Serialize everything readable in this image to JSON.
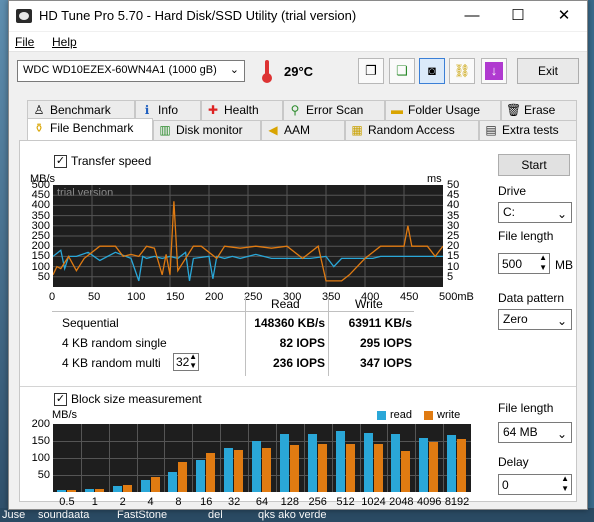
{
  "window": {
    "title": "HD Tune Pro 5.70 - Hard Disk/SSD Utility (trial version)",
    "minimize": "—",
    "maximize": "☐",
    "close": "✕"
  },
  "menu": [
    "File",
    "Help"
  ],
  "toolbar": {
    "drive": "WDC WD10EZEX-60WN4A1 (1000 gB)",
    "temperature": "29°C",
    "exit_label": "Exit",
    "icons": [
      "copy-text-icon",
      "copy-info-icon",
      "screenshot-camera-icon",
      "options-chain-icon",
      "save-arrow-icon"
    ]
  },
  "tabs_top": [
    {
      "label": "Benchmark",
      "icon": "dumbbell-icon"
    },
    {
      "label": "Info",
      "icon": "info-icon"
    },
    {
      "label": "Health",
      "icon": "health-cross-icon"
    },
    {
      "label": "Error Scan",
      "icon": "magnifier-icon"
    },
    {
      "label": "Folder Usage",
      "icon": "folder-icon"
    },
    {
      "label": "Erase",
      "icon": "trash-icon"
    }
  ],
  "tabs_bottom": [
    {
      "label": "File Benchmark",
      "icon": "file-benchmark-icon",
      "active": true
    },
    {
      "label": "Disk monitor",
      "icon": "disk-monitor-icon"
    },
    {
      "label": "AAM",
      "icon": "speaker-icon"
    },
    {
      "label": "Random Access",
      "icon": "random-access-icon"
    },
    {
      "label": "Extra tests",
      "icon": "extra-tests-icon"
    }
  ],
  "transfer": {
    "checkbox_label": "Transfer speed",
    "checked": true,
    "y_unit_left": "MB/s",
    "y_unit_right": "ms",
    "watermark": "trial version",
    "y_ticks_left": [
      "500",
      "450",
      "400",
      "350",
      "300",
      "250",
      "200",
      "150",
      "100",
      "50"
    ],
    "y_ticks_right": [
      "50",
      "45",
      "40",
      "35",
      "30",
      "25",
      "20",
      "15",
      "10",
      "5"
    ],
    "x_ticks": [
      "0",
      "50",
      "100",
      "150",
      "200",
      "250",
      "300",
      "350",
      "400",
      "450",
      "500mB"
    ]
  },
  "results": {
    "col_read": "Read",
    "col_write": "Write",
    "rows": [
      {
        "label": "Sequential",
        "read": "148360 KB/s",
        "write": "63911 KB/s"
      },
      {
        "label": "4 KB random single",
        "read": "82 IOPS",
        "write": "295 IOPS"
      },
      {
        "label": "4 KB random multi",
        "read": "236 IOPS",
        "write": "347 IOPS"
      }
    ],
    "queue_depth": "32"
  },
  "right_top": {
    "start_label": "Start",
    "drive_label": "Drive",
    "drive_value": "C:",
    "file_length_label": "File length",
    "file_length_value": "500",
    "file_length_unit": "MB",
    "pattern_label": "Data pattern",
    "pattern_value": "Zero"
  },
  "block": {
    "checkbox_label": "Block size measurement",
    "checked": true,
    "y_unit": "MB/s",
    "legend_read": "read",
    "legend_write": "write",
    "y_ticks": [
      "200",
      "150",
      "100",
      "50"
    ]
  },
  "right_bottom": {
    "file_length_label": "File length",
    "file_length_value": "64 MB",
    "delay_label": "Delay",
    "delay_value": "0"
  },
  "colors": {
    "read": "#2aa7d8",
    "write": "#e07b12",
    "graph_bg": "#1e1e1e",
    "grid": "#555555"
  },
  "taskbar": [
    "Juse",
    "soundaata",
    "FastStone",
    "del",
    "qks ako verde"
  ],
  "chart_data": [
    {
      "type": "line",
      "title": "",
      "xlabel": "",
      "ylabel": "MB/s",
      "xlim": [
        0,
        500
      ],
      "ylim": [
        0,
        500
      ],
      "series": [
        {
          "name": "Read",
          "x": [
            0,
            10,
            15,
            20,
            30,
            45,
            60,
            80,
            100,
            110,
            115,
            120,
            130,
            140,
            150,
            160,
            170,
            175,
            180,
            200,
            205,
            210,
            220,
            230,
            240,
            260,
            280,
            300,
            310,
            330,
            350,
            360,
            370,
            380,
            400,
            410,
            420,
            440,
            460,
            480,
            500
          ],
          "y": [
            150,
            180,
            90,
            150,
            150,
            170,
            130,
            170,
            140,
            30,
            150,
            140,
            150,
            140,
            150,
            140,
            170,
            30,
            140,
            150,
            40,
            150,
            140,
            150,
            140,
            160,
            140,
            140,
            140,
            140,
            150,
            100,
            140,
            140,
            140,
            140,
            150,
            150,
            150,
            150,
            150
          ]
        },
        {
          "name": "Write",
          "x": [
            0,
            5,
            10,
            20,
            30,
            40,
            60,
            80,
            90,
            100,
            110,
            120,
            130,
            140,
            145,
            150,
            155,
            160,
            180,
            190,
            210,
            220,
            240,
            260,
            280,
            300,
            320,
            340,
            350,
            360,
            370,
            380,
            400,
            420,
            440,
            450,
            455,
            460,
            480,
            490,
            500
          ],
          "y": [
            60,
            100,
            90,
            150,
            80,
            140,
            200,
            200,
            150,
            160,
            150,
            200,
            190,
            60,
            160,
            60,
            420,
            80,
            200,
            200,
            140,
            200,
            190,
            200,
            190,
            200,
            140,
            200,
            30,
            30,
            30,
            60,
            140,
            200,
            200,
            200,
            300,
            200,
            200,
            150,
            200
          ]
        }
      ]
    },
    {
      "type": "bar",
      "title": "",
      "xlabel": "",
      "ylabel": "MB/s",
      "ylim": [
        0,
        200
      ],
      "categories": [
        "0.5",
        "1",
        "2",
        "4",
        "8",
        "16",
        "32",
        "64",
        "128",
        "256",
        "512",
        "1024",
        "2048",
        "4096",
        "8192"
      ],
      "series": [
        {
          "name": "read",
          "values": [
            5,
            10,
            18,
            35,
            58,
            95,
            128,
            150,
            172,
            172,
            180,
            175,
            172,
            160,
            168
          ]
        },
        {
          "name": "write",
          "values": [
            5,
            8,
            20,
            45,
            88,
            115,
            125,
            130,
            138,
            142,
            140,
            140,
            120,
            148,
            155
          ]
        }
      ]
    }
  ]
}
